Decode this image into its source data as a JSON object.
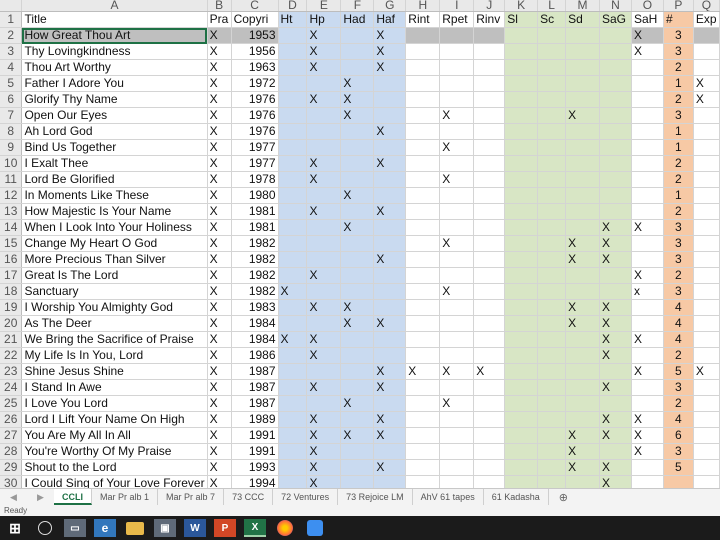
{
  "columns": [
    "",
    "A",
    "B",
    "C",
    "D",
    "E",
    "F",
    "G",
    "H",
    "I",
    "J",
    "K",
    "L",
    "M",
    "N",
    "O",
    "P",
    "Q"
  ],
  "header_row": [
    "Title",
    "Pra",
    "Copyri",
    "Ht",
    "Hp",
    "Had",
    "Haf",
    "Rint",
    "Rpet",
    "Rinv",
    "Sl",
    "Sc",
    "Sd",
    "SaG",
    "SaH",
    "#",
    "Exp"
  ],
  "rows": [
    {
      "n": "2",
      "t": "How Great Thou Art",
      "b": "X",
      "c": "1953",
      "d": "",
      "e": "X",
      "f": "",
      "g": "X",
      "h": "",
      "i": "",
      "j": "",
      "k": "",
      "l": "",
      "m": "",
      "n2": "",
      "o": "X",
      "p": "3",
      "q": ""
    },
    {
      "n": "3",
      "t": "Thy Lovingkindness",
      "b": "X",
      "c": "1956",
      "d": "",
      "e": "X",
      "f": "",
      "g": "X",
      "h": "",
      "i": "",
      "j": "",
      "k": "",
      "l": "",
      "m": "",
      "n2": "",
      "o": "X",
      "p": "3",
      "q": ""
    },
    {
      "n": "4",
      "t": "Thou Art Worthy",
      "b": "X",
      "c": "1963",
      "d": "",
      "e": "X",
      "f": "",
      "g": "X",
      "h": "",
      "i": "",
      "j": "",
      "k": "",
      "l": "",
      "m": "",
      "n2": "",
      "o": "",
      "p": "2",
      "q": ""
    },
    {
      "n": "5",
      "t": "Father I Adore You",
      "b": "X",
      "c": "1972",
      "d": "",
      "e": "",
      "f": "X",
      "g": "",
      "h": "",
      "i": "",
      "j": "",
      "k": "",
      "l": "",
      "m": "",
      "n2": "",
      "o": "",
      "p": "1",
      "q": "X"
    },
    {
      "n": "6",
      "t": "Glorify Thy Name",
      "b": "X",
      "c": "1976",
      "d": "",
      "e": "X",
      "f": "X",
      "g": "",
      "h": "",
      "i": "",
      "j": "",
      "k": "",
      "l": "",
      "m": "",
      "n2": "",
      "o": "",
      "p": "2",
      "q": "X"
    },
    {
      "n": "7",
      "t": "Open Our Eyes",
      "b": "X",
      "c": "1976",
      "d": "",
      "e": "",
      "f": "X",
      "g": "",
      "h": "",
      "i": "X",
      "j": "",
      "k": "",
      "l": "",
      "m": "X",
      "n2": "",
      "o": "",
      "p": "3",
      "q": ""
    },
    {
      "n": "8",
      "t": "Ah Lord God",
      "b": "X",
      "c": "1976",
      "d": "",
      "e": "",
      "f": "",
      "g": "X",
      "h": "",
      "i": "",
      "j": "",
      "k": "",
      "l": "",
      "m": "",
      "n2": "",
      "o": "",
      "p": "1",
      "q": ""
    },
    {
      "n": "9",
      "t": "Bind Us Together",
      "b": "X",
      "c": "1977",
      "d": "",
      "e": "",
      "f": "",
      "g": "",
      "h": "",
      "i": "X",
      "j": "",
      "k": "",
      "l": "",
      "m": "",
      "n2": "",
      "o": "",
      "p": "1",
      "q": ""
    },
    {
      "n": "10",
      "t": "I Exalt Thee",
      "b": "X",
      "c": "1977",
      "d": "",
      "e": "X",
      "f": "",
      "g": "X",
      "h": "",
      "i": "",
      "j": "",
      "k": "",
      "l": "",
      "m": "",
      "n2": "",
      "o": "",
      "p": "2",
      "q": ""
    },
    {
      "n": "11",
      "t": "Lord Be Glorified",
      "b": "X",
      "c": "1978",
      "d": "",
      "e": "X",
      "f": "",
      "g": "",
      "h": "",
      "i": "X",
      "j": "",
      "k": "",
      "l": "",
      "m": "",
      "n2": "",
      "o": "",
      "p": "2",
      "q": ""
    },
    {
      "n": "12",
      "t": "In Moments Like These",
      "b": "X",
      "c": "1980",
      "d": "",
      "e": "",
      "f": "X",
      "g": "",
      "h": "",
      "i": "",
      "j": "",
      "k": "",
      "l": "",
      "m": "",
      "n2": "",
      "o": "",
      "p": "1",
      "q": ""
    },
    {
      "n": "13",
      "t": "How Majestic Is Your Name",
      "b": "X",
      "c": "1981",
      "d": "",
      "e": "X",
      "f": "",
      "g": "X",
      "h": "",
      "i": "",
      "j": "",
      "k": "",
      "l": "",
      "m": "",
      "n2": "",
      "o": "",
      "p": "2",
      "q": ""
    },
    {
      "n": "14",
      "t": "When I Look Into Your Holiness",
      "b": "X",
      "c": "1981",
      "d": "",
      "e": "",
      "f": "X",
      "g": "",
      "h": "",
      "i": "",
      "j": "",
      "k": "",
      "l": "",
      "m": "",
      "n2": "X",
      "o": "X",
      "p": "3",
      "q": ""
    },
    {
      "n": "15",
      "t": "Change My Heart O God",
      "b": "X",
      "c": "1982",
      "d": "",
      "e": "",
      "f": "",
      "g": "",
      "h": "",
      "i": "X",
      "j": "",
      "k": "",
      "l": "",
      "m": "X",
      "n2": "X",
      "o": "",
      "p": "3",
      "q": ""
    },
    {
      "n": "16",
      "t": "More Precious Than Silver",
      "b": "X",
      "c": "1982",
      "d": "",
      "e": "",
      "f": "",
      "g": "X",
      "h": "",
      "i": "",
      "j": "",
      "k": "",
      "l": "",
      "m": "X",
      "n2": "X",
      "o": "",
      "p": "3",
      "q": ""
    },
    {
      "n": "17",
      "t": "Great Is The Lord",
      "b": "X",
      "c": "1982",
      "d": "",
      "e": "X",
      "f": "",
      "g": "",
      "h": "",
      "i": "",
      "j": "",
      "k": "",
      "l": "",
      "m": "",
      "n2": "",
      "o": "X",
      "p": "2",
      "q": ""
    },
    {
      "n": "18",
      "t": "Sanctuary",
      "b": "X",
      "c": "1982",
      "d": "X",
      "e": "",
      "f": "",
      "g": "",
      "h": "",
      "i": "X",
      "j": "",
      "k": "",
      "l": "",
      "m": "",
      "n2": "",
      "o": "x",
      "p": "3",
      "q": ""
    },
    {
      "n": "19",
      "t": "I Worship You Almighty God",
      "b": "X",
      "c": "1983",
      "d": "",
      "e": "X",
      "f": "X",
      "g": "",
      "h": "",
      "i": "",
      "j": "",
      "k": "",
      "l": "",
      "m": "X",
      "n2": "X",
      "o": "",
      "p": "4",
      "q": ""
    },
    {
      "n": "20",
      "t": "As The Deer",
      "b": "X",
      "c": "1984",
      "d": "",
      "e": "",
      "f": "X",
      "g": "X",
      "h": "",
      "i": "",
      "j": "",
      "k": "",
      "l": "",
      "m": "X",
      "n2": "X",
      "o": "",
      "p": "4",
      "q": ""
    },
    {
      "n": "21",
      "t": "We Bring the Sacrifice of Praise",
      "b": "X",
      "c": "1984",
      "d": "X",
      "e": "X",
      "f": "",
      "g": "",
      "h": "",
      "i": "",
      "j": "",
      "k": "",
      "l": "",
      "m": "",
      "n2": "X",
      "o": "X",
      "p": "4",
      "q": ""
    },
    {
      "n": "22",
      "t": "My Life Is In You, Lord",
      "b": "X",
      "c": "1986",
      "d": "",
      "e": "X",
      "f": "",
      "g": "",
      "h": "",
      "i": "",
      "j": "",
      "k": "",
      "l": "",
      "m": "",
      "n2": "X",
      "o": "",
      "p": "2",
      "q": ""
    },
    {
      "n": "23",
      "t": "Shine Jesus Shine",
      "b": "X",
      "c": "1987",
      "d": "",
      "e": "",
      "f": "",
      "g": "X",
      "h": "X",
      "i": "X",
      "j": "X",
      "k": "",
      "l": "",
      "m": "",
      "n2": "",
      "o": "X",
      "p": "5",
      "q": "X"
    },
    {
      "n": "24",
      "t": "I Stand In Awe",
      "b": "X",
      "c": "1987",
      "d": "",
      "e": "X",
      "f": "",
      "g": "X",
      "h": "",
      "i": "",
      "j": "",
      "k": "",
      "l": "",
      "m": "",
      "n2": "X",
      "o": "",
      "p": "3",
      "q": ""
    },
    {
      "n": "25",
      "t": "I Love You Lord",
      "b": "X",
      "c": "1987",
      "d": "",
      "e": "",
      "f": "X",
      "g": "",
      "h": "",
      "i": "X",
      "j": "",
      "k": "",
      "l": "",
      "m": "",
      "n2": "",
      "o": "",
      "p": "2",
      "q": ""
    },
    {
      "n": "26",
      "t": "Lord I Lift Your Name On High",
      "b": "X",
      "c": "1989",
      "d": "",
      "e": "X",
      "f": "",
      "g": "X",
      "h": "",
      "i": "",
      "j": "",
      "k": "",
      "l": "",
      "m": "",
      "n2": "X",
      "o": "X",
      "p": "4",
      "q": ""
    },
    {
      "n": "27",
      "t": "You Are My All In All",
      "b": "X",
      "c": "1991",
      "d": "",
      "e": "X",
      "f": "X",
      "g": "X",
      "h": "",
      "i": "",
      "j": "",
      "k": "",
      "l": "",
      "m": "X",
      "n2": "X",
      "o": "X",
      "p": "6",
      "q": ""
    },
    {
      "n": "28",
      "t": "You're Worthy Of My Praise",
      "b": "X",
      "c": "1991",
      "d": "",
      "e": "X",
      "f": "",
      "g": "",
      "h": "",
      "i": "",
      "j": "",
      "k": "",
      "l": "",
      "m": "X",
      "n2": "",
      "o": "X",
      "p": "3",
      "q": ""
    },
    {
      "n": "29",
      "t": "Shout to the Lord",
      "b": "X",
      "c": "1993",
      "d": "",
      "e": "X",
      "f": "",
      "g": "X",
      "h": "",
      "i": "",
      "j": "",
      "k": "",
      "l": "",
      "m": "X",
      "n2": "X",
      "o": "",
      "p": "5",
      "q": ""
    },
    {
      "n": "30",
      "t": "I Could Sing of Your Love Forever",
      "b": "X",
      "c": "1994",
      "d": "",
      "e": "X",
      "f": "",
      "g": "",
      "h": "",
      "i": "",
      "j": "",
      "k": "",
      "l": "",
      "m": "",
      "n2": "X",
      "o": "",
      "p": "",
      "q": ""
    }
  ],
  "sheet_tabs": [
    "CCLI",
    "Mar Pr alb 1",
    "Mar Pr alb 7",
    "73 CCC",
    "72 Ventures",
    "73 Rejoice LM",
    "AhV 61 tapes",
    "61 Kadasha"
  ],
  "active_tab": "CCLI",
  "status": "Ready",
  "colors": {
    "blue": "#c9daf0",
    "green": "#d8e6c5",
    "orange": "#f7c9a5",
    "header": "#e9e9e9",
    "taskbar": "#1b1b1b"
  },
  "taskbar": {
    "search_icon": "search-icon",
    "word": "W",
    "ppt": "P",
    "excel": "X"
  }
}
